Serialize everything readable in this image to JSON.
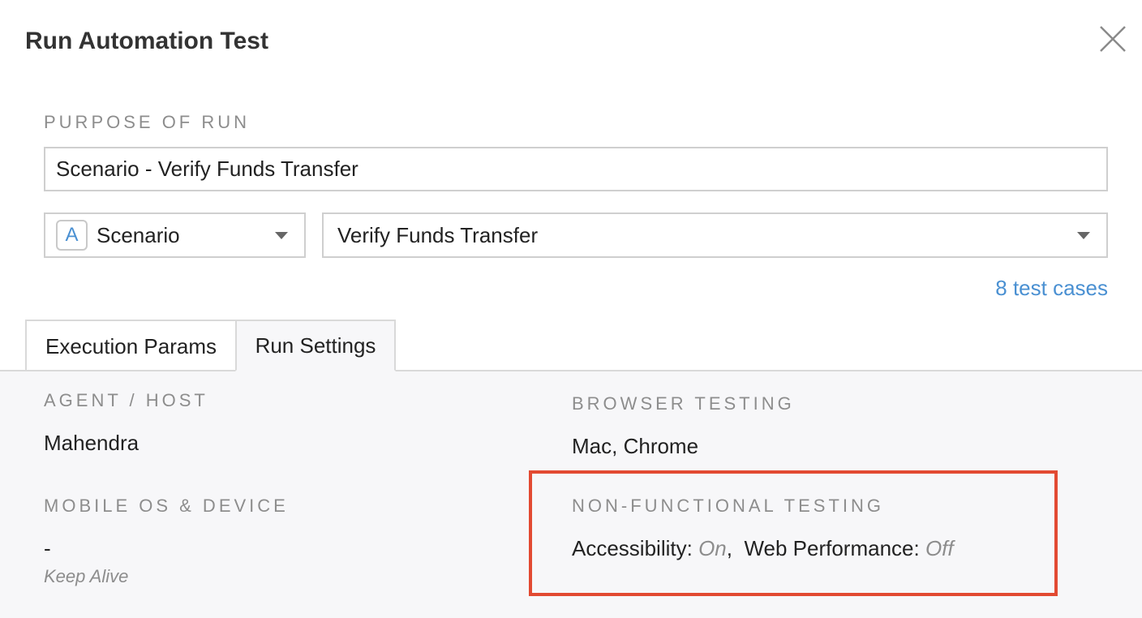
{
  "dialog": {
    "title": "Run Automation Test"
  },
  "purpose": {
    "label": "PURPOSE OF RUN",
    "value": "Scenario - Verify Funds Transfer"
  },
  "type_select": {
    "badge": "A",
    "value": "Scenario"
  },
  "target_select": {
    "value": "Verify Funds Transfer"
  },
  "test_cases_link": "8 test cases",
  "tabs": [
    {
      "label": "Execution Params",
      "active": false
    },
    {
      "label": "Run Settings",
      "active": true
    }
  ],
  "settings": {
    "agent_host": {
      "label": "AGENT / HOST",
      "value": "Mahendra"
    },
    "browser_testing": {
      "label": "BROWSER TESTING",
      "os": "Mac,",
      "browser": "Chrome"
    },
    "mobile": {
      "label": "MOBILE OS & DEVICE",
      "value": "-",
      "note": "Keep Alive"
    },
    "non_functional": {
      "label": "NON-FUNCTIONAL TESTING",
      "accessibility_label": "Accessibility:",
      "accessibility_value": "On",
      "separator": ",",
      "web_performance_label": "Web Performance:",
      "web_performance_value": "Off"
    }
  },
  "colors": {
    "accent": "#4a90d2",
    "highlight": "#e24a32",
    "label_gray": "#8d8d8d",
    "panel_bg": "#f7f7f9"
  },
  "icons": {
    "close": "close-icon",
    "caret": "chevron-down-icon"
  }
}
